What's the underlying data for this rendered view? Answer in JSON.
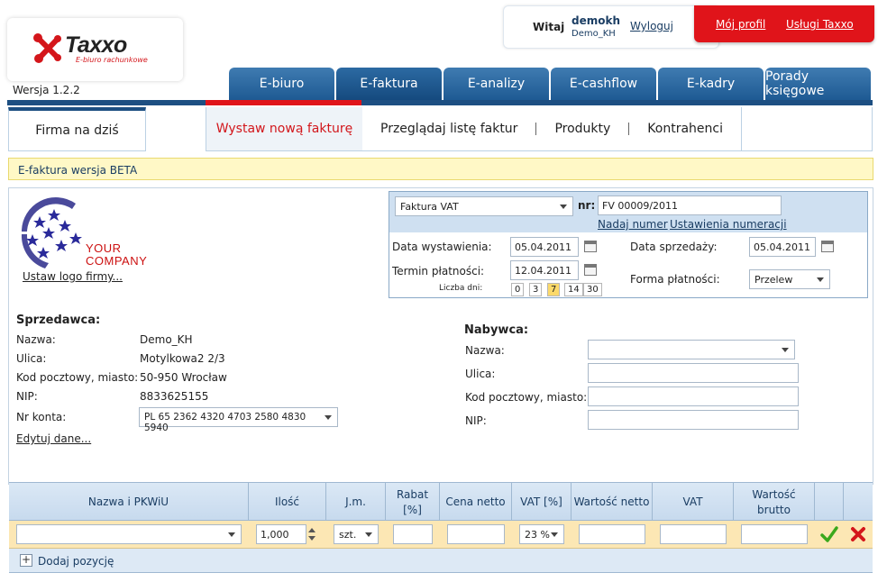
{
  "brand": {
    "name": "Taxxo",
    "tagline": "E-biuro rachunkowe"
  },
  "version": "Wersja 1.2.2",
  "user": {
    "greeting": "Witaj",
    "login": "demokh",
    "company": "Demo_KH",
    "logout": "Wyloguj"
  },
  "top_links": {
    "profile": "Mój profil",
    "services": "Usługi Taxxo"
  },
  "tabs": [
    "E-biuro",
    "E-faktura",
    "E-analizy",
    "E-cashflow",
    "E-kadry",
    "Porady księgowe"
  ],
  "firma_na_dzis": "Firma na dziś",
  "subnav": [
    "Wystaw nową fakturę",
    "Przeglądaj listę faktur",
    "Produkty",
    "Kontrahenci"
  ],
  "beta_notice": "E-faktura wersja BETA",
  "logo": {
    "line1": "YOUR",
    "line2": "COMPANY",
    "set_logo": "Ustaw logo firmy..."
  },
  "document": {
    "type": "Faktura VAT",
    "nr_label": "nr:",
    "number": "FV 00009/2011",
    "assign_number": "Nadaj numer",
    "numbering_settings": "Ustawienia numeracji",
    "issue_date_label": "Data wystawienia:",
    "issue_date": "05.04.2011",
    "sale_date_label": "Data sprzedaży:",
    "sale_date": "05.04.2011",
    "payment_term_label": "Termin płatności:",
    "payment_term": "12.04.2011",
    "days_label": "Liczba dni:",
    "days": [
      "0",
      "3",
      "7",
      "14",
      "30"
    ],
    "payment_form_label": "Forma płatności:",
    "payment_form": "Przelew"
  },
  "seller": {
    "title": "Sprzedawca:",
    "fields": [
      {
        "label": "Nazwa:",
        "value": "Demo_KH"
      },
      {
        "label": "Ulica:",
        "value": "Motylkowa2 2/3"
      },
      {
        "label": "Kod pocztowy, miasto:",
        "value": "50-950 Wrocław"
      },
      {
        "label": "NIP:",
        "value": "8833625155"
      }
    ],
    "account_label": "Nr konta:",
    "account": "PL 65 2362 4320 4703 2580 4830 5940",
    "edit": "Edytuj dane..."
  },
  "buyer": {
    "title": "Nabywca:",
    "labels": [
      "Nazwa:",
      "Ulica:",
      "Kod pocztowy, miasto:",
      "NIP:"
    ]
  },
  "table": {
    "headers": [
      "Nazwa i PKWiU",
      "Ilość",
      "J.m.",
      "Rabat [%]",
      "Cena netto",
      "VAT [%]",
      "Wartość netto",
      "VAT",
      "Wartość brutto"
    ],
    "row": {
      "quantity": "1,000",
      "unit": "szt.",
      "vat": "23 %"
    },
    "add_position": "Dodaj pozycję"
  },
  "colors": {
    "brand_red": "#e0141a",
    "nav_blue": "#1d4f82",
    "beta_bg": "#fff8c6",
    "row_bg": "#fce7b4"
  }
}
